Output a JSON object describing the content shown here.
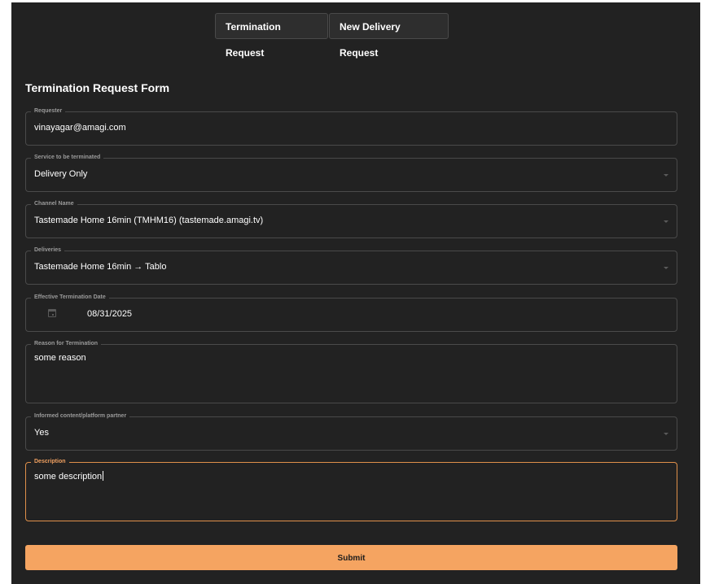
{
  "tabs": [
    {
      "label": "Termination Request"
    },
    {
      "label": "New Delivery Request"
    }
  ],
  "form": {
    "title": "Termination Request Form",
    "requester": {
      "label": "Requester",
      "value": "vinayagar@amagi.com"
    },
    "service": {
      "label": "Service to be terminated",
      "value": "Delivery Only"
    },
    "channel": {
      "label": "Channel Name",
      "value": "Tastemade Home 16min (TMHM16) (tastemade.amagi.tv)"
    },
    "deliveries": {
      "label": "Deliveries",
      "value": "Tastemade Home 16min → Tablo"
    },
    "date": {
      "label": "Effective Termination Date",
      "value": "08/31/2025",
      "icon": "calendar-icon"
    },
    "reason": {
      "label": "Reason for Termination",
      "value": "some reason"
    },
    "informed": {
      "label": "Informed content/platform partner",
      "value": "Yes"
    },
    "description": {
      "label": "Description",
      "value": "some description"
    }
  },
  "submit_label": "Submit",
  "colors": {
    "background": "#222222",
    "accent": "#f5a461",
    "focus_border": "#e0904a",
    "text": "#ffffff",
    "label": "#9a9a9a"
  }
}
